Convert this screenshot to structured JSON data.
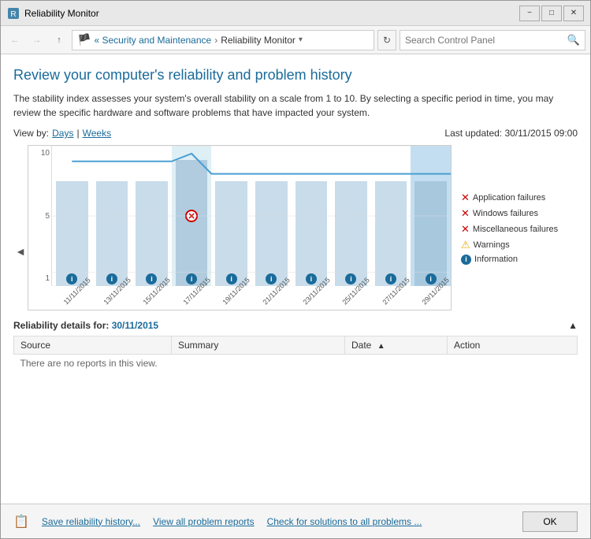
{
  "window": {
    "title": "Reliability Monitor",
    "minimize_label": "−",
    "maximize_label": "□",
    "close_label": "✕"
  },
  "address": {
    "back_label": "←",
    "forward_label": "→",
    "up_label": "↑",
    "breadcrumb_pre": "« Security and Maintenance",
    "breadcrumb_sep": ">",
    "breadcrumb_current": "Reliability Monitor",
    "refresh_label": "↻",
    "search_placeholder": "Search Control Panel",
    "search_icon": "🔍"
  },
  "content": {
    "page_title": "Review your computer's reliability and problem history",
    "description": "The stability index assesses your system's overall stability on a scale from 1 to 10. By selecting a specific period in time, you may review the specific hardware and software problems that have impacted your system.",
    "view_by_label": "View by:",
    "view_days": "Days",
    "view_weeks": "Weeks",
    "last_updated": "Last updated: 30/11/2015 09:00"
  },
  "chart": {
    "y_max": "10",
    "y_mid": "5",
    "y_min": "1",
    "left_arrow": "◄",
    "right_arrow": "►",
    "dates": [
      "11/11/2015",
      "13/11/2015",
      "15/11/2015",
      "17/11/2015",
      "19/11/2015",
      "21/11/2015",
      "23/11/2015",
      "25/11/2015",
      "27/11/2015",
      "29/11/2015"
    ],
    "legend": {
      "app_failures": "Application failures",
      "win_failures": "Windows failures",
      "misc_failures": "Miscellaneous failures",
      "warnings": "Warnings",
      "information": "Information"
    }
  },
  "details": {
    "header_pre": "Reliability details for:",
    "header_date": "30/11/2015",
    "cols": {
      "source": "Source",
      "summary": "Summary",
      "date": "Date",
      "action": "Action"
    },
    "empty_message": "There are no reports in this view."
  },
  "footer": {
    "save_link": "Save reliability history...",
    "view_link": "View all problem reports",
    "check_link": "Check for solutions to all problems ...",
    "ok_label": "OK"
  }
}
